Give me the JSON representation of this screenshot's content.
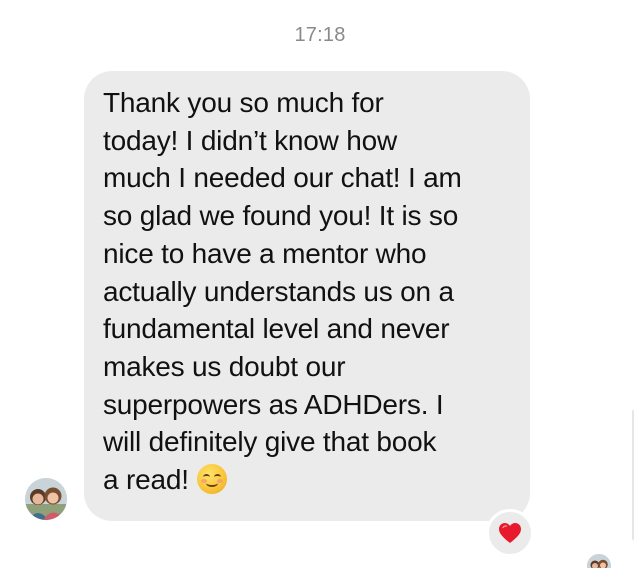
{
  "conversation": {
    "timestamp": "17:18",
    "message": {
      "lines": [
        "Thank you so much for",
        "today! I didn’t know how",
        "much I needed our chat! I am",
        "so glad we found you!  It is so",
        "nice to have a mentor who",
        "actually understands us on a",
        "fundamental level and never",
        "makes us doubt our",
        "superpowers as ADHDers. I",
        "will definitely give that book",
        "a read!"
      ],
      "trailing_emoji": "smiling-face-with-smiling-eyes",
      "reaction": "red-heart"
    },
    "sender_avatar": "sender-avatar-photo",
    "seen_avatar": "seen-avatar-photo"
  },
  "colors": {
    "background": "#ffffff",
    "bubble": "#ebebeb",
    "text": "#111111",
    "timestamp": "#8a8a8e",
    "heart": "#e8192c"
  }
}
